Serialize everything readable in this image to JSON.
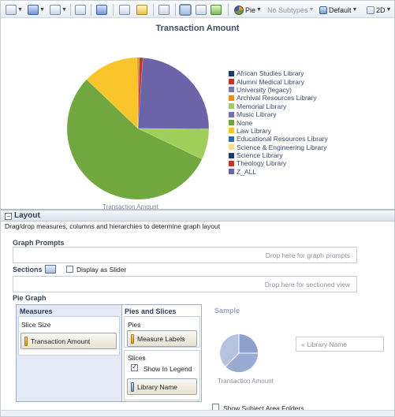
{
  "toolbar": {
    "chart_type_label": "Pie",
    "subtype_label": "No Subtypes",
    "style_label": "Default",
    "dimension_label": "2D"
  },
  "chart_data": {
    "type": "pie",
    "title": "Transaction Amount",
    "caption": "Transaction Amount",
    "legend_placement": "right",
    "legend": [
      {
        "name": "African Studies Library",
        "color": "#1f3a6d"
      },
      {
        "name": "Alumni Medical Library",
        "color": "#c0392b"
      },
      {
        "name": "University (legacy)",
        "color": "#7b78b6"
      },
      {
        "name": "Archival Resources Library",
        "color": "#e8901d"
      },
      {
        "name": "Memorial Library",
        "color": "#9fcf5a"
      },
      {
        "name": "Music Library",
        "color": "#7a6fb0"
      },
      {
        "name": "None",
        "color": "#70a83f"
      },
      {
        "name": "Law Library",
        "color": "#f7c52b"
      },
      {
        "name": "Educational Resources Library",
        "color": "#2c6fb0"
      },
      {
        "name": "Science & Engineering Library",
        "color": "#f3de8a"
      },
      {
        "name": "Science Library",
        "color": "#23396c"
      },
      {
        "name": "Theology Library",
        "color": "#c0392b"
      },
      {
        "name": "Z_ALL",
        "color": "#6d63a8"
      }
    ],
    "slices": [
      {
        "name": "Theology Library",
        "value": 0.8,
        "color": "#c0392b"
      },
      {
        "name": "Z_ALL",
        "value": 24.0,
        "color": "#6d63a8"
      },
      {
        "name": "Memorial Library",
        "value": 7.0,
        "color": "#9fcf5a"
      },
      {
        "name": "None",
        "value": 55.0,
        "color": "#70a83f"
      },
      {
        "name": "Law Library",
        "value": 12.7,
        "color": "#f7c52b"
      },
      {
        "name": "Archival Resources Library",
        "value": 0.5,
        "color": "#e8901d"
      }
    ]
  },
  "layout": {
    "title": "Layout",
    "instructions": "Drag/drop measures, columns and hierarchies to determine graph layout",
    "graph_prompts_label": "Graph Prompts",
    "graph_prompts_drop": "Drop here for graph prompts",
    "sections_label": "Sections",
    "display_as_slider_label": "Display as Slider",
    "sections_drop": "Drop here for sectioned view",
    "pie_graph_label": "Pie Graph",
    "measures_title": "Measures",
    "slice_size_label": "Slice Size",
    "transaction_amount_label": "Transaction Amount",
    "pies_slices_title": "Pies and Slices",
    "pies_label": "Pies",
    "measure_labels_label": "Measure Labels",
    "slices_label": "Slices",
    "show_in_legend_label": "Show In Legend",
    "library_name_label": "Library Name",
    "sample_title": "Sample",
    "sample_caption": "Transaction Amount",
    "sample_input_text": "« Library Name",
    "show_subject_area_folders_label": "Show Subject Area Folders"
  }
}
